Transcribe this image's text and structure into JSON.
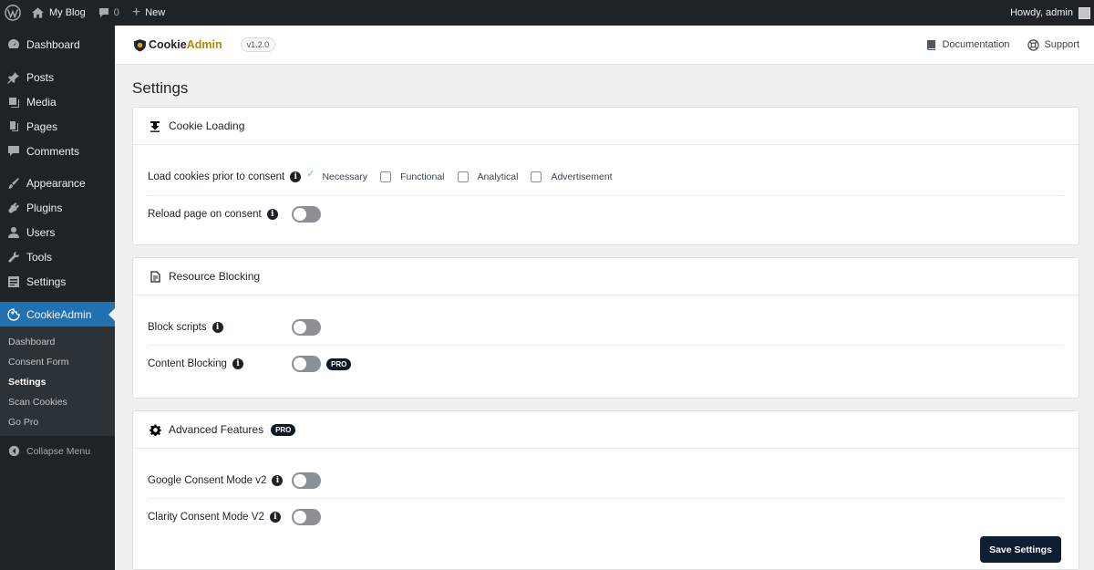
{
  "adminbar": {
    "site_name": "My Blog",
    "comments_count": "0",
    "new_label": "New",
    "howdy": "Howdy, admin"
  },
  "sidebar": {
    "items": [
      {
        "label": "Dashboard",
        "icon": "dashboard-icon"
      },
      {
        "label": "Posts",
        "icon": "pin-icon"
      },
      {
        "label": "Media",
        "icon": "media-icon"
      },
      {
        "label": "Pages",
        "icon": "pages-icon"
      },
      {
        "label": "Comments",
        "icon": "comment-icon"
      },
      {
        "label": "Appearance",
        "icon": "brush-icon"
      },
      {
        "label": "Plugins",
        "icon": "plugin-icon"
      },
      {
        "label": "Users",
        "icon": "user-icon"
      },
      {
        "label": "Tools",
        "icon": "wrench-icon"
      },
      {
        "label": "Settings",
        "icon": "settings-icon"
      },
      {
        "label": "CookieAdmin",
        "icon": "cookie-icon"
      }
    ],
    "submenu": [
      "Dashboard",
      "Consent Form",
      "Settings",
      "Scan Cookies",
      "Go Pro"
    ],
    "collapse_label": "Collapse Menu"
  },
  "header": {
    "brand_cookie": "Cookie",
    "brand_admin": "Admin",
    "version": "v1.2.0",
    "documentation": "Documentation",
    "support": "Support"
  },
  "page_title": "Settings",
  "cookie_loading": {
    "title": "Cookie Loading",
    "load_label": "Load cookies prior to consent",
    "options": [
      "Necessary",
      "Functional",
      "Analytical",
      "Advertisement"
    ],
    "reload_label": "Reload page on consent"
  },
  "resource_blocking": {
    "title": "Resource Blocking",
    "block_scripts": "Block scripts",
    "content_blocking": "Content Blocking",
    "pro": "PRO"
  },
  "advanced": {
    "title": "Advanced Features",
    "pro": "PRO",
    "google": "Google Consent Mode v2",
    "clarity": "Clarity Consent Mode V2"
  },
  "save_label": "Save Settings",
  "colors": {
    "wp_dark": "#1d2327",
    "accent": "#2271b1",
    "save_button": "#0f1e33"
  }
}
